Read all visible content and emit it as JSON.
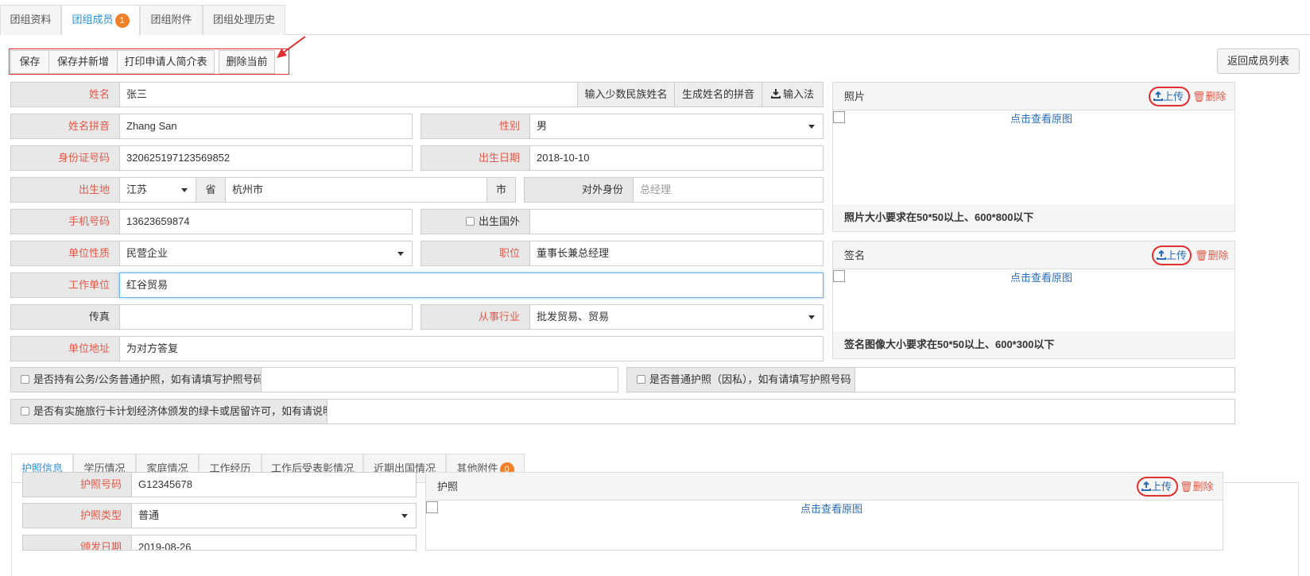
{
  "top_tabs": {
    "items": [
      {
        "label": "团组资料"
      },
      {
        "label": "团组成员",
        "badge": "1"
      },
      {
        "label": "团组附件"
      },
      {
        "label": "团组处理历史"
      }
    ]
  },
  "toolbar": {
    "save": "保存",
    "save_new": "保存并新增",
    "print": "打印申请人简介表",
    "delete_current": "删除当前",
    "back_to_list": "返回成员列表"
  },
  "form": {
    "name": {
      "label": "姓名",
      "value": "张三"
    },
    "name_btns": {
      "minority": "输入少数民族姓名",
      "pinyin": "生成姓名的拼音",
      "ime": "输入法"
    },
    "pinyin": {
      "label": "姓名拼音",
      "value": "Zhang San"
    },
    "gender": {
      "label": "性别",
      "value": "男"
    },
    "id_number": {
      "label": "身份证号码",
      "value": "320625197123569852"
    },
    "birth_date": {
      "label": "出生日期",
      "value": "2018-10-10"
    },
    "birthplace": {
      "label": "出生地",
      "province": "江苏",
      "province_suffix": "省",
      "city": "杭州市",
      "city_suffix": "市"
    },
    "external_identity": {
      "label": "对外身份",
      "placeholder": "总经理"
    },
    "phone": {
      "label": "手机号码",
      "value": "13623659874"
    },
    "born_abroad": {
      "label": "出生国外",
      "value": ""
    },
    "unit_nature": {
      "label": "单位性质",
      "value": "民营企业"
    },
    "position": {
      "label": "职位",
      "value": "董事长兼总经理"
    },
    "work_unit": {
      "label": "工作单位",
      "value": "红谷贸易"
    },
    "fax": {
      "label": "传真",
      "value": ""
    },
    "industry": {
      "label": "从事行业",
      "value": "批发贸易、贸易"
    },
    "unit_address": {
      "label": "单位地址",
      "value": "为对方答复"
    },
    "official_passport": {
      "label": "是否持有公务/公务普通护照，如有请填写护照号码",
      "value": ""
    },
    "private_passport": {
      "label": "是否普通护照（因私），如有请填写护照号码",
      "value": ""
    },
    "apec_card": {
      "label": "是否有实施旅行卡计划经济体颁发的绿卡或居留许可，如有请说明",
      "value": ""
    }
  },
  "photo_panel": {
    "title": "照片",
    "upload": "上传",
    "delete": "删除",
    "view_original": "点击查看原图",
    "note": "照片大小要求在50*50以上、600*800以下"
  },
  "signature_panel": {
    "title": "签名",
    "upload": "上传",
    "delete": "删除",
    "view_original": "点击查看原图",
    "note": "签名图像大小要求在50*50以上、600*300以下"
  },
  "bottom_tabs": {
    "items": [
      {
        "label": "护照信息"
      },
      {
        "label": "学历情况"
      },
      {
        "label": "家庭情况"
      },
      {
        "label": "工作经历"
      },
      {
        "label": "工作后受表彰情况"
      },
      {
        "label": "近期出国情况"
      },
      {
        "label": "其他附件",
        "badge": "0"
      }
    ]
  },
  "passport": {
    "number": {
      "label": "护照号码",
      "value": "G12345678"
    },
    "type": {
      "label": "护照类型",
      "value": "普通"
    },
    "issue_date": {
      "label": "颁发日期",
      "value": "2019-08-26"
    },
    "panel": {
      "title": "护照",
      "upload": "上传",
      "delete": "删除",
      "view_original": "点击查看原图"
    }
  },
  "colors": {
    "accent": "#2d8ed3",
    "required_label": "#e05a4a",
    "highlight": "#e03030",
    "badge": "#f0812a"
  }
}
